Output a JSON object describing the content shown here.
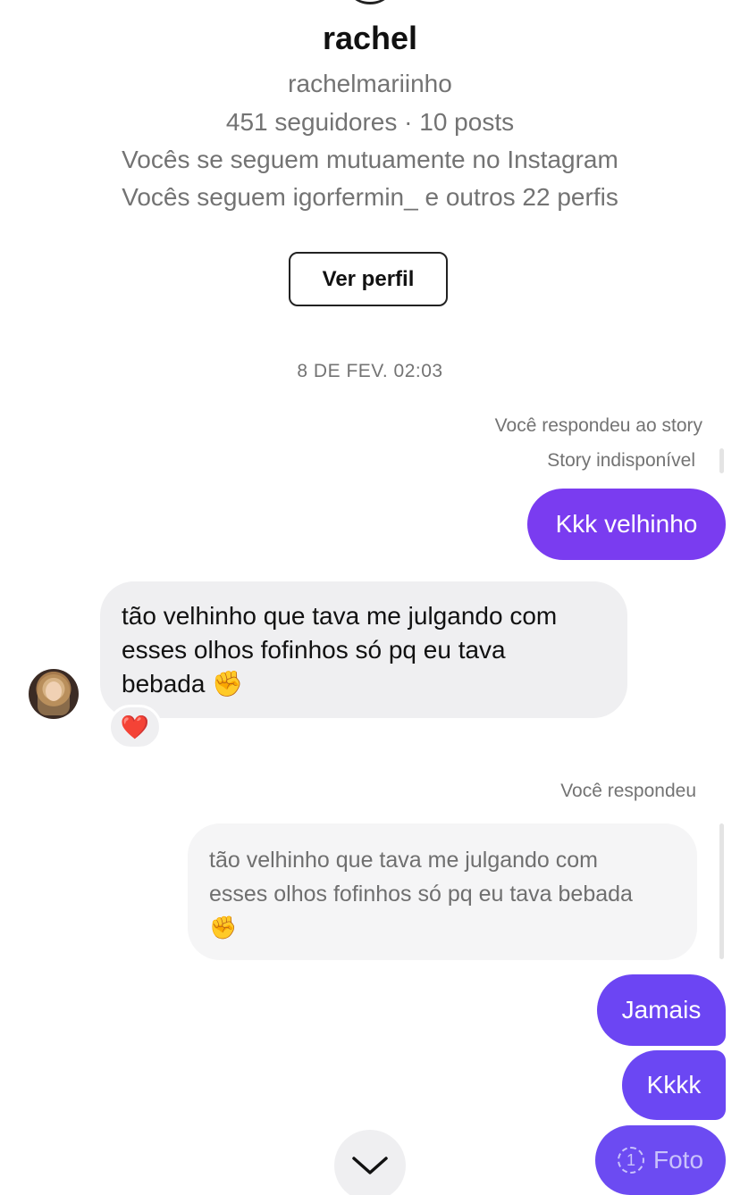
{
  "profile": {
    "name": "rachel",
    "username": "rachelmariinho",
    "stats": "451 seguidores · 10 posts",
    "mutual": "Vocês se seguem mutuamente no Instagram",
    "followed_by": "Vocês seguem igorfermin_ e outros 22 perfis",
    "view_profile_label": "Ver perfil"
  },
  "conversation": {
    "timestamp": "8 DE FEV. 02:03",
    "story_reply": {
      "label": "Você respondeu ao story",
      "story_status": "Story indisponível",
      "message": "Kkk velhinho"
    },
    "incoming": {
      "line1": "tão velhinho que tava me julgando com",
      "line2": "esses olhos fofinhos só pq eu tava",
      "line3": "bebada ✊",
      "reaction": "❤️"
    },
    "reply": {
      "label": "Você respondeu",
      "quoted_line1": "tão velhinho que tava me julgando com",
      "quoted_line2": "esses olhos fofinhos só pq eu tava bebada",
      "quoted_line3": "✊"
    },
    "outgoing_messages": [
      "Jamais",
      "Kkkk"
    ],
    "view_once_photo": {
      "count": "1",
      "label": "Foto"
    }
  },
  "colors": {
    "outgoing_bubble_1": "#7a3cf0",
    "outgoing_bubble_2": "#6a43f3",
    "incoming_bubble": "#efeff1",
    "secondary_text": "#737373"
  },
  "icons": {
    "scroll_down": "chevron-down-icon",
    "view_once": "view-once-icon"
  }
}
